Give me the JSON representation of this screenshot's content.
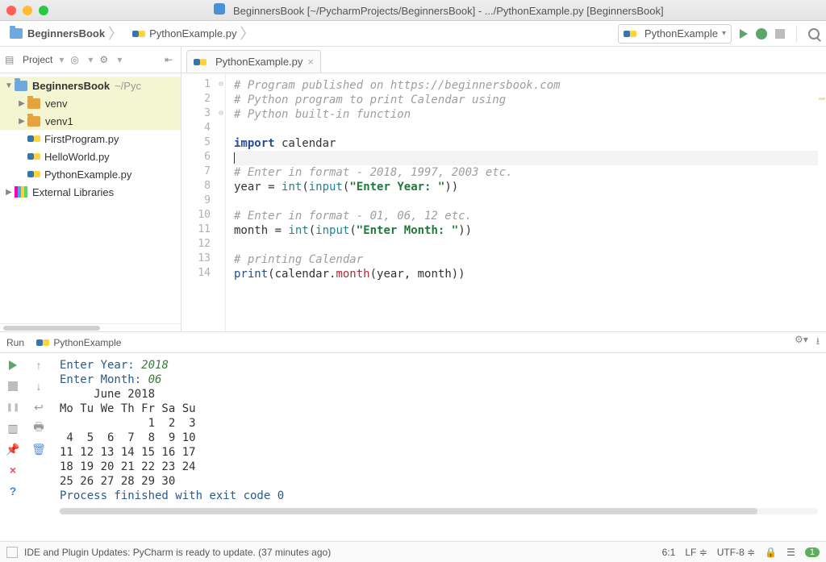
{
  "window": {
    "title": "BeginnersBook [~/PycharmProjects/BeginnersBook] - .../PythonExample.py [BeginnersBook]"
  },
  "breadcrumbs": {
    "project": "BeginnersBook",
    "file": "PythonExample.py"
  },
  "runconfig": {
    "name": "PythonExample"
  },
  "sidebar": {
    "toolLabel": "Project",
    "root": "BeginnersBook",
    "rootPath": "~/Pyc",
    "items": [
      {
        "name": "venv"
      },
      {
        "name": "venv1"
      },
      {
        "name": "FirstProgram.py"
      },
      {
        "name": "HelloWorld.py"
      },
      {
        "name": "PythonExample.py"
      }
    ],
    "external": "External Libraries"
  },
  "editor": {
    "tab": "PythonExample.py",
    "lines": [
      {
        "n": 1,
        "fold": "⊖",
        "html": "<span class='c'># Program published on https://beginnersbook.com</span>"
      },
      {
        "n": 2,
        "html": "<span class='c'># Python program to print Calendar using</span>"
      },
      {
        "n": 3,
        "fold": "⊖",
        "html": "<span class='c'># Python built-in function</span>"
      },
      {
        "n": 4,
        "html": ""
      },
      {
        "n": 5,
        "html": "<span class='k'>import</span> calendar"
      },
      {
        "n": 6,
        "caret": true,
        "html": "<span class='cursor'></span>"
      },
      {
        "n": 7,
        "html": "<span class='c'># Enter in format - 2018, 1997, 2003 etc.</span>"
      },
      {
        "n": 8,
        "html": "year = <span class='bi'>int</span>(<span class='bi'>input</span>(<span class='s'>\"Enter Year: \"</span>))"
      },
      {
        "n": 9,
        "html": ""
      },
      {
        "n": 10,
        "html": "<span class='c'># Enter in format - 01, 06, 12 etc.</span>"
      },
      {
        "n": 11,
        "html": "month = <span class='bi'>int</span>(<span class='bi'>input</span>(<span class='s'>\"Enter Month: \"</span>))"
      },
      {
        "n": 12,
        "html": ""
      },
      {
        "n": 13,
        "html": "<span class='c'># printing Calendar</span>"
      },
      {
        "n": 14,
        "html": "<span class='fn'>print</span>(calendar.<span class='m'>month</span>(year, month))"
      }
    ]
  },
  "run": {
    "tabLabel": "Run",
    "configName": "PythonExample",
    "output": [
      {
        "text": "Enter Year: ",
        "user": "2018"
      },
      {
        "text": "Enter Month: ",
        "user": "06"
      },
      {
        "plain": "     June 2018"
      },
      {
        "plain": "Mo Tu We Th Fr Sa Su"
      },
      {
        "plain": "             1  2  3"
      },
      {
        "plain": " 4  5  6  7  8  9 10"
      },
      {
        "plain": "11 12 13 14 15 16 17"
      },
      {
        "plain": "18 19 20 21 22 23 24"
      },
      {
        "plain": "25 26 27 28 29 30"
      },
      {
        "plain": ""
      },
      {
        "text": "Process finished with exit code 0"
      }
    ]
  },
  "status": {
    "message": "IDE and Plugin Updates: PyCharm is ready to update. (37 minutes ago)",
    "caret": "6:1",
    "lineSep": "LF",
    "encoding": "UTF-8",
    "notifications": "1"
  }
}
